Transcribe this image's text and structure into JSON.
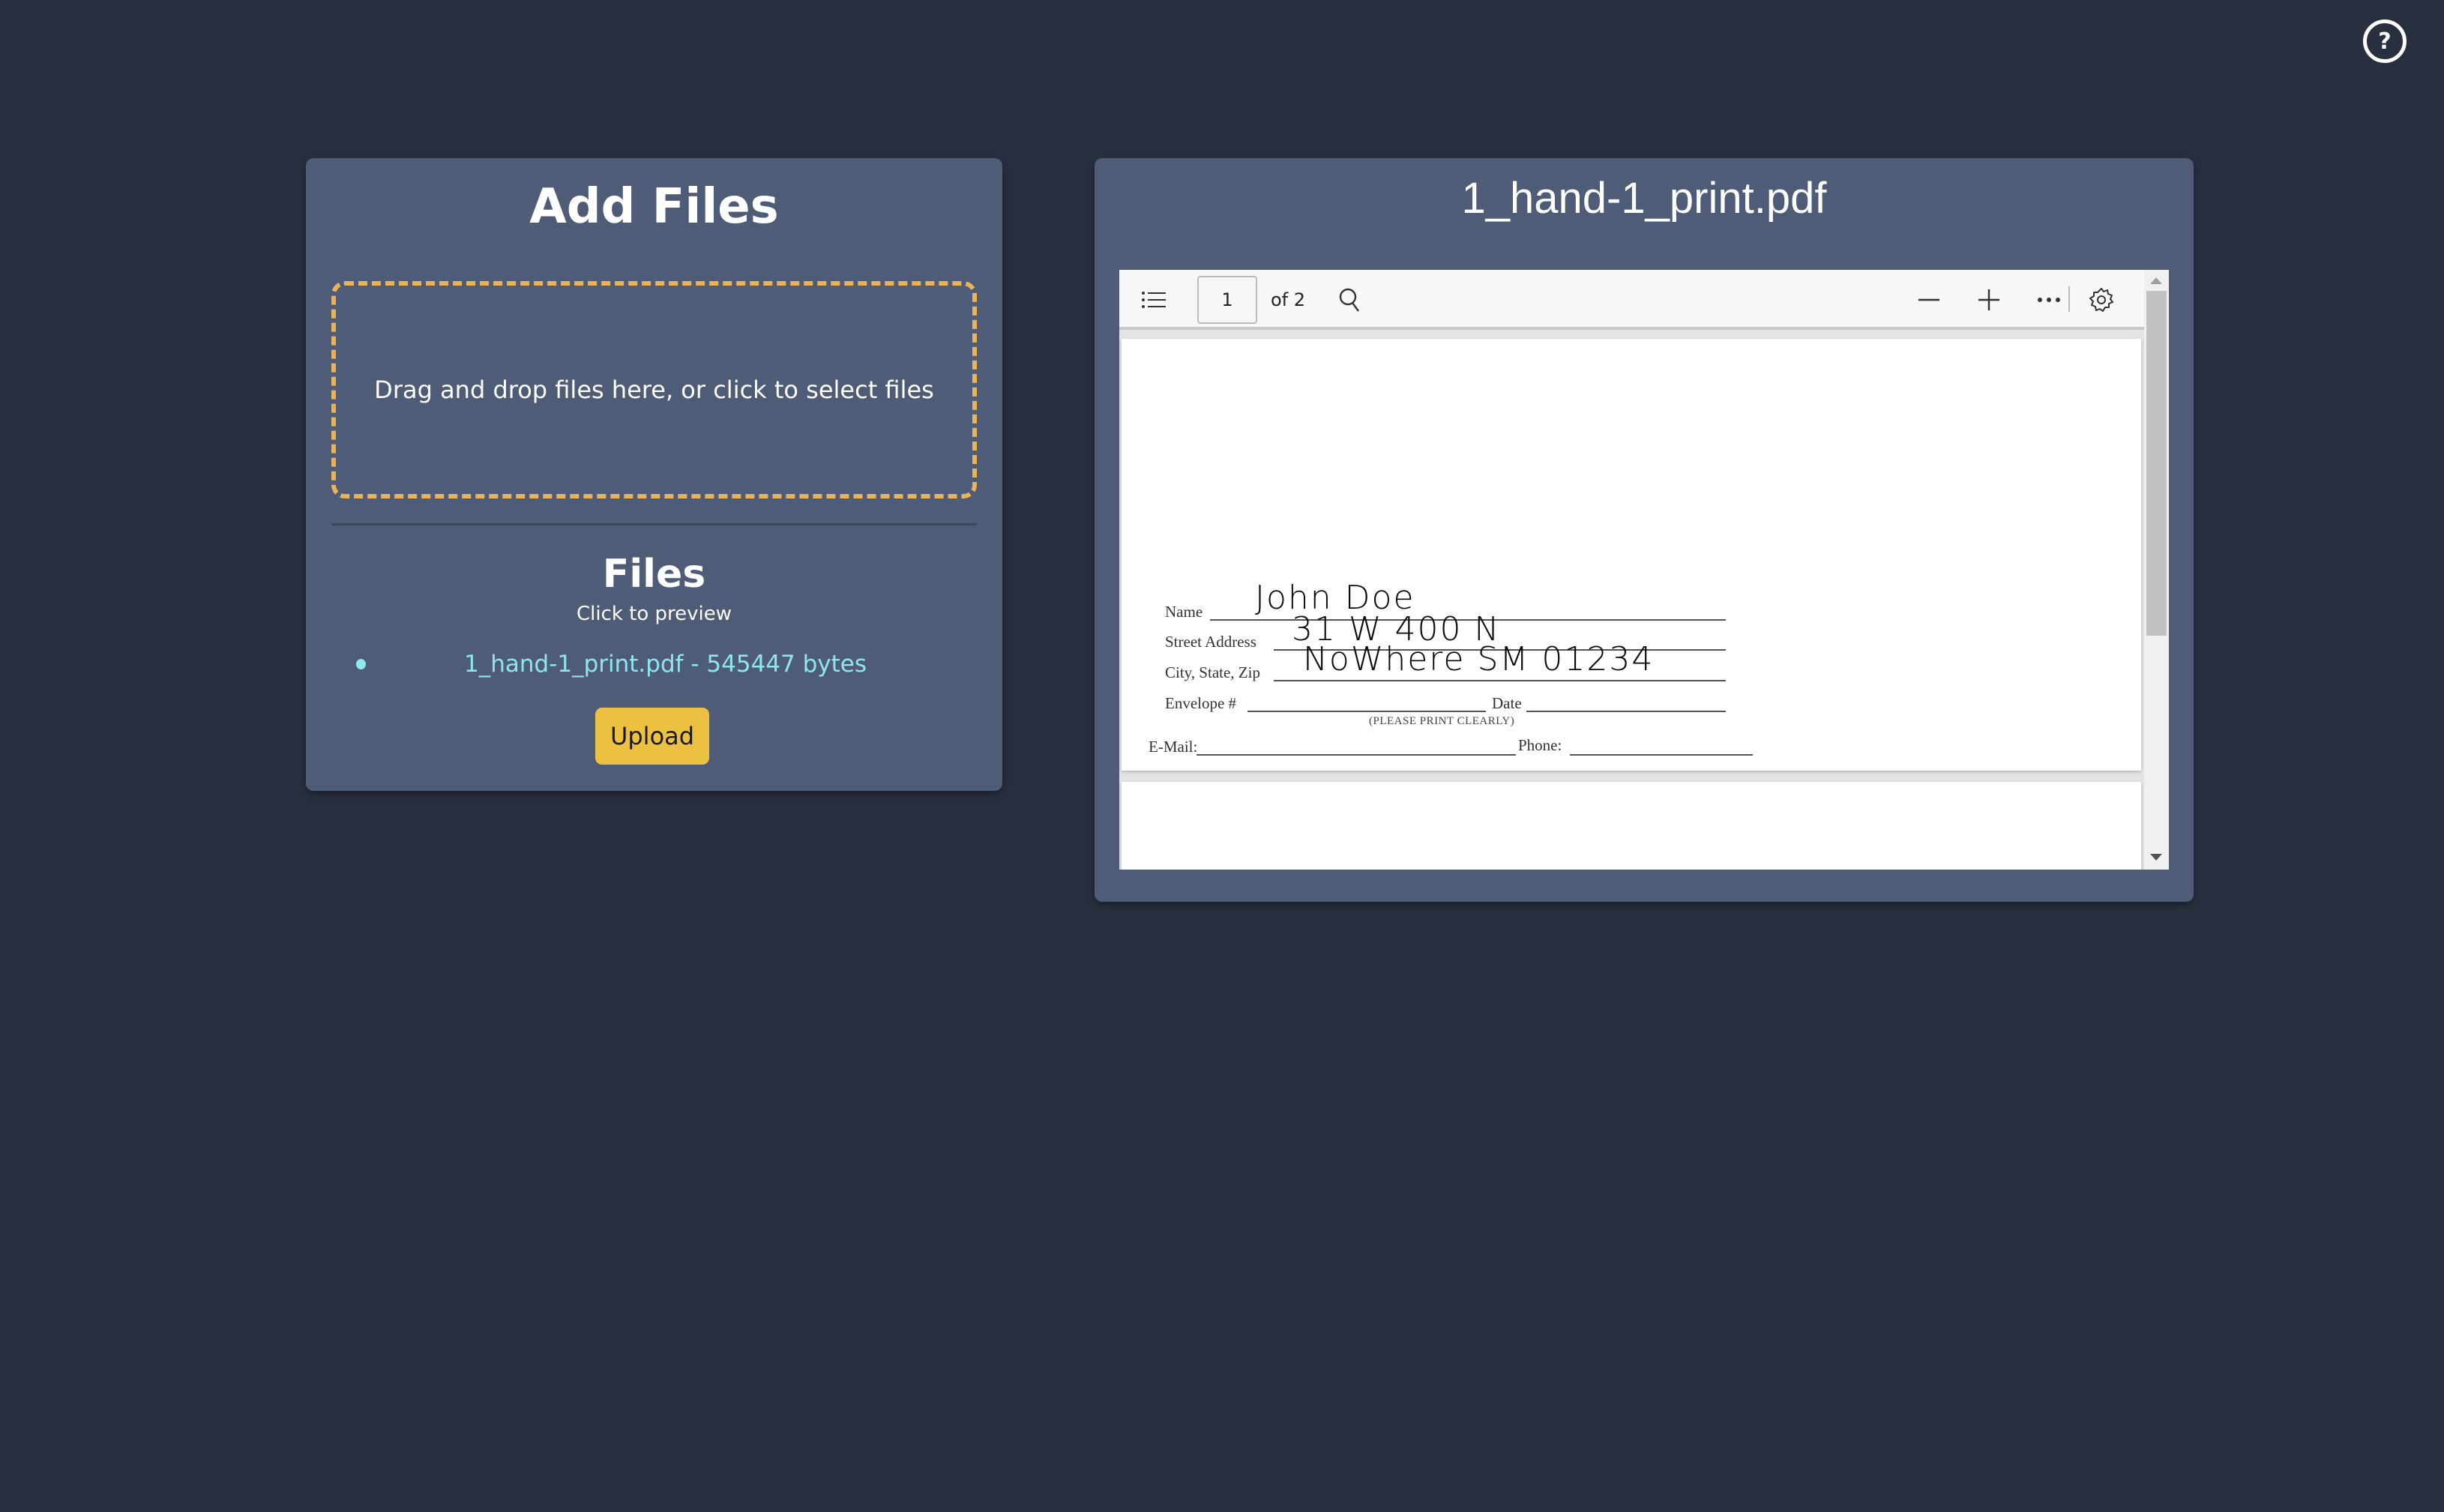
{
  "help": {
    "icon": "help-icon",
    "label": "?"
  },
  "add_files": {
    "title": "Add Files",
    "dropzone_text": "Drag and drop files here, or click to select files",
    "files_heading": "Files",
    "files_subheading": "Click to preview",
    "files": [
      {
        "label": "1_hand-1_print.pdf - 545447 bytes"
      }
    ],
    "upload_label": "Upload"
  },
  "preview": {
    "title": "1_hand-1_print.pdf",
    "toolbar": {
      "current_page": "1",
      "page_count": "of 2",
      "icons": [
        "table-of-contents-icon",
        "search-icon",
        "zoom-out-icon",
        "zoom-in-icon",
        "more-options-icon",
        "settings-icon"
      ]
    },
    "document": {
      "name_label": "Name",
      "name_value": "John Doe",
      "street_label": "Street Address",
      "street_value": "31 W 400 N",
      "city_label": "City, State, Zip",
      "city_value": "NoWhere SM 01234",
      "envelope_label": "Envelope #",
      "date_label": "Date",
      "print_note": "(PLEASE PRINT CLEARLY)",
      "email_label": "E-Mail:",
      "phone_label": "Phone:"
    }
  },
  "colors": {
    "background": "#282f3e",
    "card": "#4f5c78",
    "accent_dashed": "#e9b35a",
    "upload_button": "#ecc041",
    "file_link": "#8ee6ef"
  }
}
